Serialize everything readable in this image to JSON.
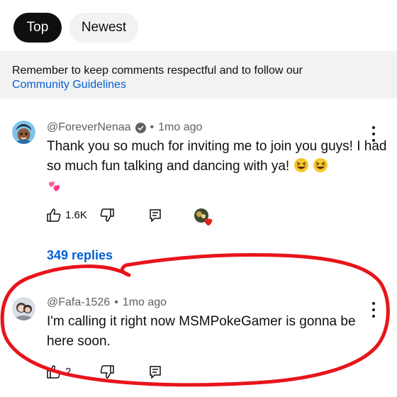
{
  "sort": {
    "top_label": "Top",
    "newest_label": "Newest"
  },
  "notice": {
    "text": "Remember to keep comments respectful and to follow our",
    "link": "Community Guidelines"
  },
  "comments": [
    {
      "author": "@ForeverNenaa",
      "verified": true,
      "time": "1mo ago",
      "text": "Thank you so much for inviting me to join you guys! I had so much fun talking and dancing with ya!",
      "emojis": [
        "grinning-squinting-face",
        "grinning-squinting-face",
        "two-hearts"
      ],
      "likes": "1.6K",
      "creator_heart": true,
      "replies_label": "349 replies"
    },
    {
      "author": "@Fafa-1526",
      "verified": false,
      "time": "1mo ago",
      "text": "I'm calling it right now MSMPokeGamer is gonna be here soon.",
      "likes": "2"
    }
  ],
  "colors": {
    "link": "#065fd4",
    "chip_active_bg": "#0f0f0f",
    "chip_bg": "#f2f2f2",
    "meta_text": "#606060",
    "annotation": "#e8141b"
  }
}
